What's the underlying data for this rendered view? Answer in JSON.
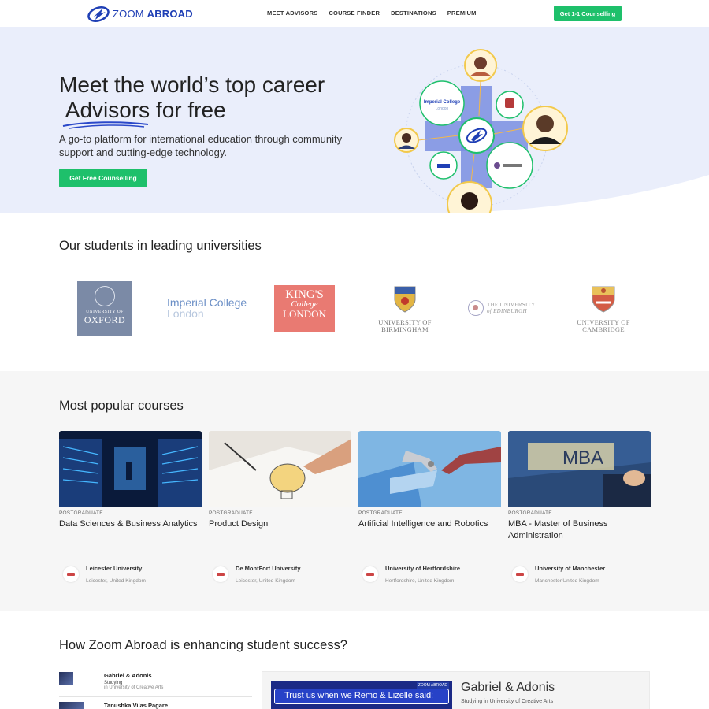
{
  "brand": {
    "name_light": "ZOOM ",
    "name_bold": "ABROAD",
    "color": "#1f3fb5"
  },
  "nav": {
    "links": [
      "MEET ADVISORS",
      "COURSE FINDER",
      "DESTINATIONS",
      "PREMIUM"
    ],
    "cta": "Get 1-1 Counselling"
  },
  "hero": {
    "title_line1": "Meet the world’s top career",
    "title_highlight": "Advisors",
    "title_line2_rest": " for free",
    "subtitle": "A go-to platform for international education through community support and cutting-edge technology.",
    "cta": "Get Free Counselling",
    "graphic_labels": {
      "imperial": "Imperial College",
      "imperial_2": "London"
    }
  },
  "universities": {
    "title": "Our students in leading universities",
    "oxford": {
      "line1": "UNIVERSITY OF",
      "line2": "OXFORD"
    },
    "imperial": {
      "line1": "Imperial College",
      "line2": "London"
    },
    "kings": {
      "line1": "KING'S",
      "line2": "College",
      "line3": "LONDON"
    },
    "birmingham": {
      "line1": "UNIVERSITY OF",
      "line2": "BIRMINGHAM"
    },
    "edinburgh": {
      "line1": "THE UNIVERSITY",
      "line2": "of EDINBURGH"
    },
    "cambridge": {
      "line1": "UNIVERSITY OF",
      "line2": "CAMBRIDGE"
    }
  },
  "courses": {
    "title": "Most popular courses",
    "items": [
      {
        "level": "POSTGRADUATE",
        "title": "Data Sciences & Business Analytics",
        "university": "Leicester University",
        "location": "Leicester, United Kingdom"
      },
      {
        "level": "POSTGRADUATE",
        "title": "Product Design",
        "university": "De MontFort University",
        "location": "Leicester, United Kingdom"
      },
      {
        "level": "POSTGRADUATE",
        "title": "Artificial Intelligence and Robotics",
        "university": "University of Hertfordshire",
        "location": "Hertfordshire, United Kingdom"
      },
      {
        "level": "POSTGRADUATE",
        "title": "MBA - Master of Business Administration",
        "university": "University of Manchester",
        "location": "Manchester,United Kingdom",
        "image_text": "MBA"
      }
    ]
  },
  "success": {
    "title": "How Zoom Abroad is enhancing student success?",
    "list": [
      {
        "name": "Gabriel & Adonis",
        "status": "Studying",
        "where": "in University of Creative Arts"
      },
      {
        "name": "Tanushka Vilas Pagare"
      }
    ],
    "featured": {
      "name": "Gabriel & Adonis",
      "sub": "Studying in University of Creative Arts",
      "video_text": "Trust us when we Remo & Lizelle said:",
      "video_logo": "ZOOM ABROAD"
    }
  }
}
